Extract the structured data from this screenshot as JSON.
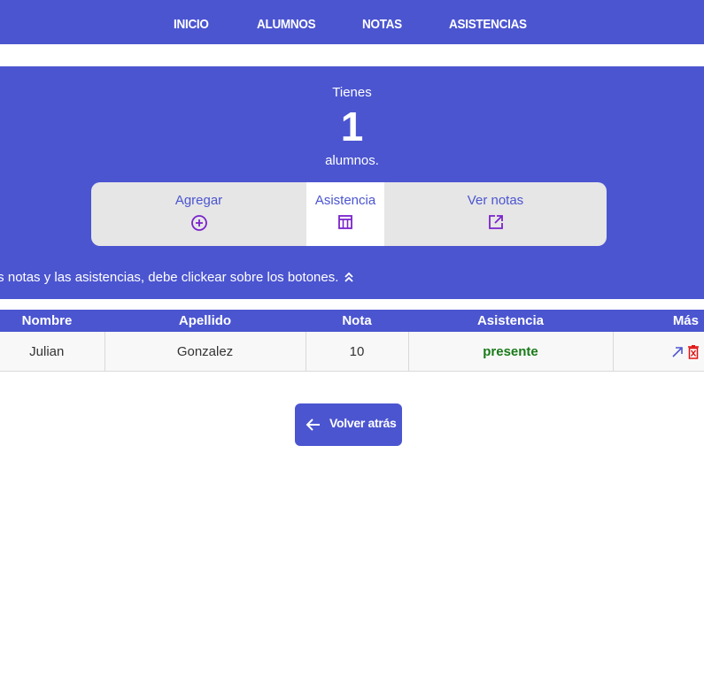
{
  "nav": [
    "INICIO",
    "ALUMNOS",
    "NOTAS",
    "ASISTENCIAS"
  ],
  "hero": {
    "prefix": "Tienes",
    "count": "1",
    "suffix": "alumnos.",
    "buttons": {
      "add": "Agregar",
      "attendance": "Asistencia",
      "grades": "Ver notas"
    },
    "hint": "ar las notas y las asistencias, debe clickear sobre los botones."
  },
  "table": {
    "headers": [
      "Nombre",
      "Apellido",
      "Nota",
      "Asistencia",
      "Más"
    ],
    "rows": [
      {
        "nombre": "Julian",
        "apellido": "Gonzalez",
        "nota": "10",
        "asistencia": "presente"
      }
    ]
  },
  "back_button": "Volver atrás",
  "colors": {
    "primary": "#4b55d0",
    "icon_purple": "#7a22cc",
    "present": "#1a7a1a",
    "delete": "#e01010"
  }
}
